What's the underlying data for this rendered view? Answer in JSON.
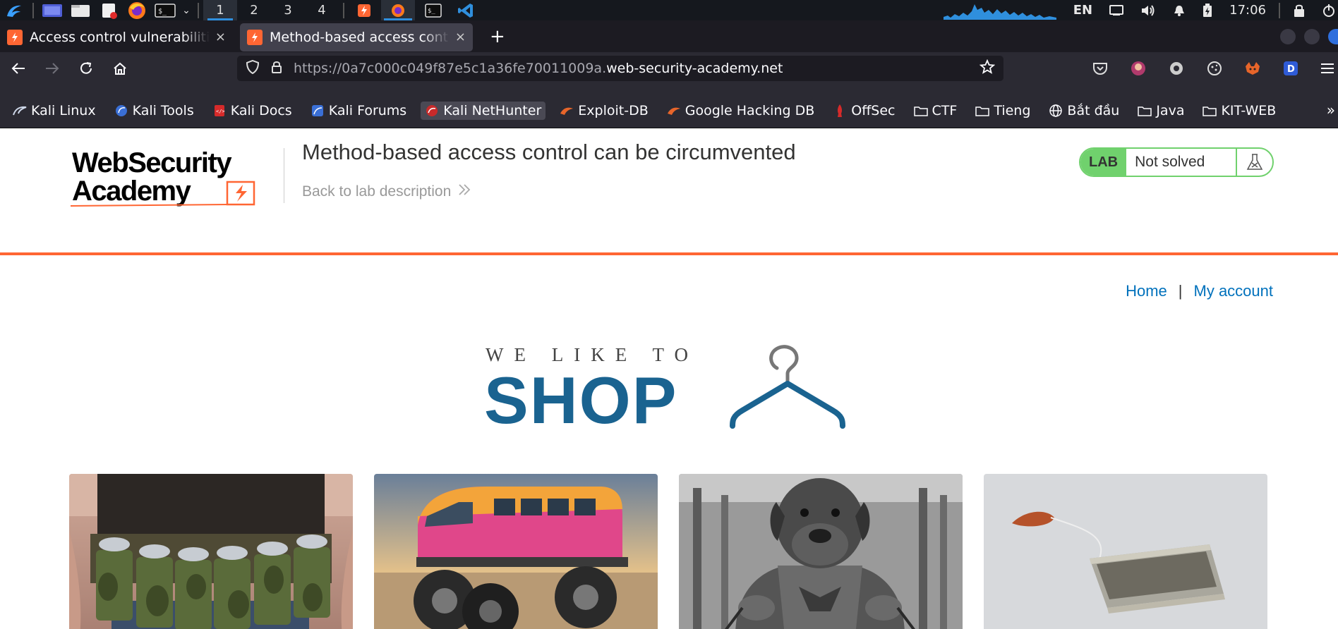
{
  "taskbar": {
    "workspaces": [
      "1",
      "2",
      "3",
      "4"
    ],
    "active_workspace": "1",
    "language": "EN",
    "clock": "17:06",
    "icons": [
      "kali-menu-icon",
      "desktop-icon",
      "files-icon",
      "text-editor-icon",
      "firefox-icon",
      "terminal-icon",
      "burp-icon",
      "firefox-active-icon",
      "terminal-app-icon",
      "vscode-icon"
    ]
  },
  "browser": {
    "tabs": [
      {
        "title": "Access control vulnerabilities",
        "active": false
      },
      {
        "title": "Method-based access control can be circumvented",
        "active": true
      }
    ],
    "new_tab": "+",
    "close_glyph": "×",
    "url_prefix": "https://0a7c000c049f87e5c1a36fe70011009a.",
    "url_host": "web-security-academy.net"
  },
  "bookmarks": [
    {
      "label": "Kali Linux",
      "icon": "kali-icon"
    },
    {
      "label": "Kali Tools",
      "icon": "kali-tools-icon"
    },
    {
      "label": "Kali Docs",
      "icon": "kali-docs-icon"
    },
    {
      "label": "Kali Forums",
      "icon": "kali-forums-icon"
    },
    {
      "label": "Kali NetHunter",
      "icon": "nethunter-icon"
    },
    {
      "label": "Exploit-DB",
      "icon": "exploit-db-icon"
    },
    {
      "label": "Google Hacking DB",
      "icon": "ghdb-icon"
    },
    {
      "label": "OffSec",
      "icon": "offsec-icon"
    },
    {
      "label": "CTF",
      "icon": "folder-icon"
    },
    {
      "label": "Tieng",
      "icon": "folder-icon"
    },
    {
      "label": "Bắt đầu",
      "icon": "globe-icon"
    },
    {
      "label": "Java",
      "icon": "folder-icon"
    },
    {
      "label": "KIT-WEB",
      "icon": "folder-icon"
    }
  ],
  "lab": {
    "logo_line1": "WebSecurity",
    "logo_line2": "Academy",
    "title": "Method-based access control can be circumvented",
    "back_link": "Back to lab description",
    "badge": "LAB",
    "status": "Not solved"
  },
  "nav": {
    "home": "Home",
    "separator": "|",
    "my_account": "My account"
  },
  "banner": {
    "tagline": "WE LIKE TO",
    "word": "SHOP"
  },
  "products": [
    {
      "name": "beer-belt-product-image"
    },
    {
      "name": "monster-van-product-image"
    },
    {
      "name": "dog-gym-product-image"
    },
    {
      "name": "tea-bag-product-image"
    }
  ],
  "colors": {
    "accent_orange": "#ff6633",
    "lab_green": "#70d16d",
    "link_blue": "#0071bc",
    "shop_blue": "#1a6390"
  }
}
